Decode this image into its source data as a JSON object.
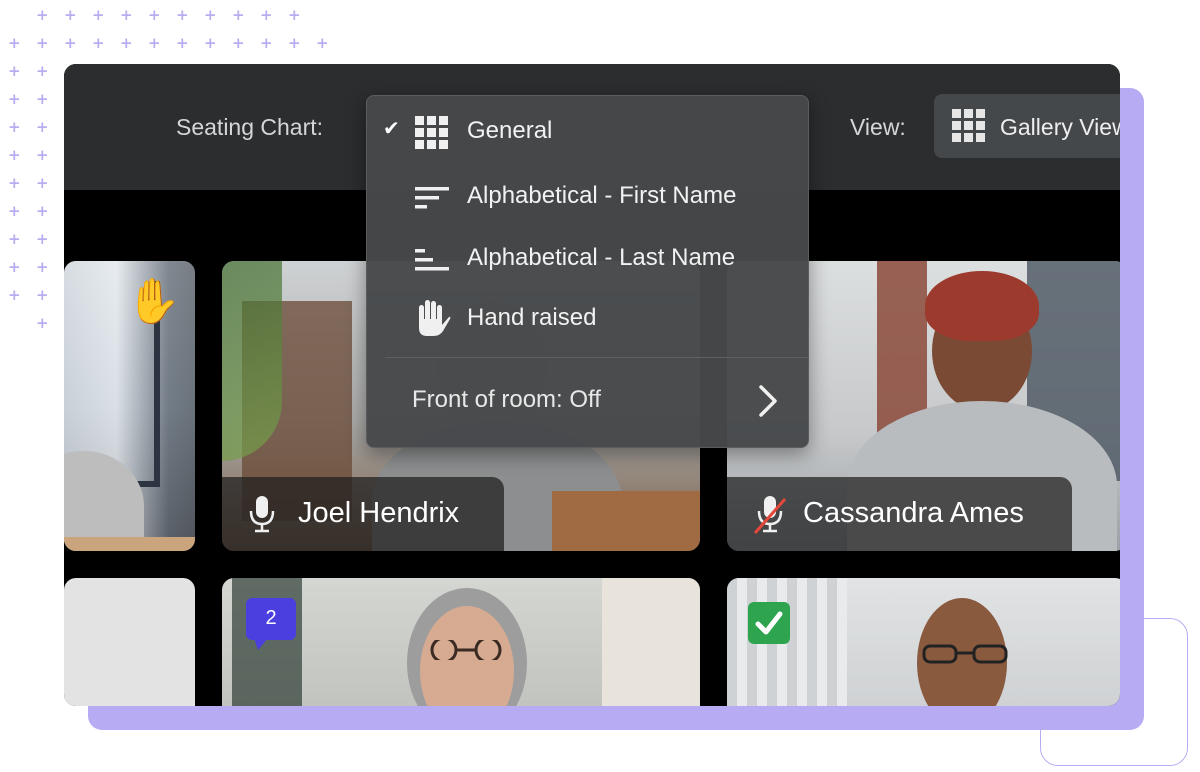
{
  "toolbar": {
    "seating_label": "Seating Chart:",
    "view_label": "View:",
    "view_value": "Gallery View"
  },
  "seating_menu": {
    "items": [
      {
        "label": "General",
        "icon": "grid-icon",
        "selected": true
      },
      {
        "label": "Alphabetical - First Name",
        "icon": "sort-lines-icon",
        "selected": false
      },
      {
        "label": "Alphabetical - Last Name",
        "icon": "sort-lines-short-icon",
        "selected": false
      },
      {
        "label": "Hand raised",
        "icon": "hand-icon",
        "selected": false
      }
    ],
    "front_of_room": "Front of room: Off"
  },
  "participants": [
    {
      "name": "Joel Hendrix",
      "mic": "on"
    },
    {
      "name": "Cassandra Ames",
      "mic": "muted"
    }
  ],
  "badges": {
    "chat_count": "2",
    "raised_hand_emoji": "✋",
    "check_emoji": "✅"
  },
  "colors": {
    "accent": "#b7acf4",
    "chat_badge": "#4b3fe0",
    "check_badge": "#2ea44f"
  }
}
